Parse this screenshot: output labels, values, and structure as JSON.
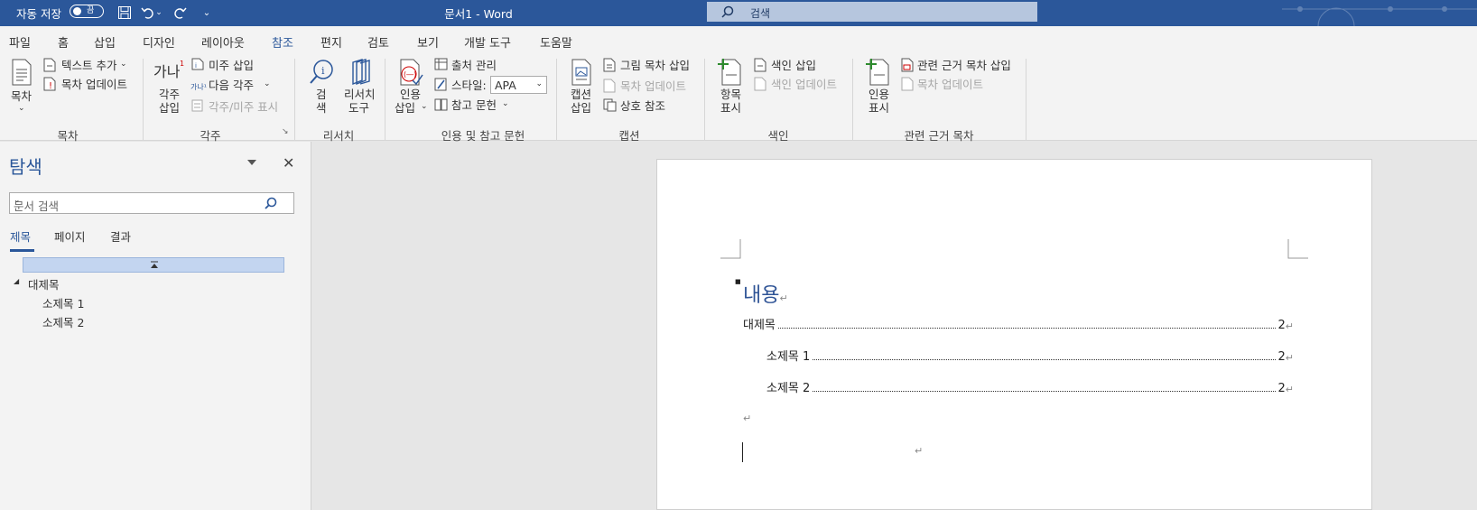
{
  "titlebar": {
    "autosave_label": "자동 저장",
    "autosave_state": "끔",
    "doc_title": "문서1  -  Word",
    "search_placeholder": "검색"
  },
  "tabs": [
    "파일",
    "홈",
    "삽입",
    "디자인",
    "레이아웃",
    "참조",
    "편지",
    "검토",
    "보기",
    "개발 도구",
    "도움말"
  ],
  "active_tab": "참조",
  "ribbon": {
    "toc": {
      "button": "목차",
      "add_text": "텍스트 추가",
      "update": "목차 업데이트",
      "group": "목차"
    },
    "footnotes": {
      "insert_line1": "각주",
      "insert_line2": "삽입",
      "icon_text": "가나",
      "endnote": "미주 삽입",
      "next": "다음 각주",
      "show": "각주/미주 표시",
      "group": "각주"
    },
    "research": {
      "search_line1": "검",
      "search_line2": "색",
      "researcher_line1": "리서치",
      "researcher_line2": "도구",
      "group": "리서치"
    },
    "citations": {
      "insert_line1": "인용",
      "insert_line2": "삽입",
      "manage": "출처 관리",
      "style_label": "스타일:",
      "style_value": "APA",
      "bibliography": "참고 문헌",
      "group": "인용 및 참고 문헌"
    },
    "captions": {
      "insert_line1": "캡션",
      "insert_line2": "삽입",
      "table_of_figures": "그림 목차 삽입",
      "update": "목차 업데이트",
      "cross_ref": "상호 참조",
      "group": "캡션"
    },
    "index": {
      "mark_line1": "항목",
      "mark_line2": "표시",
      "insert": "색인 삽입",
      "update": "색인 업데이트",
      "group": "색인"
    },
    "authorities": {
      "mark_line1": "인용",
      "mark_line2": "표시",
      "insert": "관련 근거 목차 삽입",
      "update": "목차 업데이트",
      "group": "관련 근거 목차"
    }
  },
  "nav": {
    "title": "탐색",
    "search_placeholder": "문서 검색",
    "tabs": [
      "제목",
      "페이지",
      "결과"
    ],
    "tree": {
      "heading1": "대제목",
      "sub1": "소제목 1",
      "sub2": "소제목 2"
    }
  },
  "document": {
    "toc_heading": "내용",
    "entries": [
      {
        "text": "대제목",
        "page": "2"
      },
      {
        "text": "소제목 1",
        "page": "2"
      },
      {
        "text": "소제목 2",
        "page": "2"
      }
    ],
    "para_mark": "↵"
  },
  "colors": {
    "accent": "#2b579a",
    "heading": "#2f5496"
  }
}
